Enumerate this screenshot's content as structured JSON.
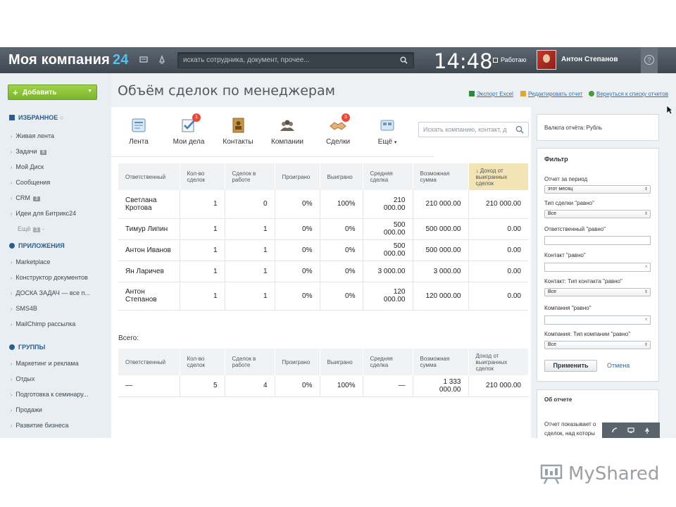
{
  "header": {
    "logo_text": "Моя компания",
    "logo_num": "24",
    "search_placeholder": "искать сотрудника, документ, прочее...",
    "clock": "14:48",
    "status": "Работаю",
    "user_name": "Антон Степанов",
    "help": "?"
  },
  "sidebar": {
    "add_button": "Добавить",
    "favorites_title": "ИЗБРАННОЕ",
    "favorites": [
      {
        "label": "Живая лента",
        "count": ""
      },
      {
        "label": "Задачи",
        "count": "8"
      },
      {
        "label": "Мой Диск",
        "count": ""
      },
      {
        "label": "Сообщения",
        "count": ""
      },
      {
        "label": "CRM",
        "count": "3"
      },
      {
        "label": "Идеи для Битрикс24",
        "count": ""
      }
    ],
    "more_label": "Ещё",
    "more_count": "1",
    "apps_title": "ПРИЛОЖЕНИЯ",
    "apps": [
      {
        "label": "Marketplace"
      },
      {
        "label": "Конструктор документов"
      },
      {
        "label": "ДОСКА ЗАДАЧ — все п..."
      },
      {
        "label": "SMS4B"
      },
      {
        "label": "MailChimp рассылка"
      }
    ],
    "groups_title": "ГРУППЫ",
    "groups": [
      {
        "label": "Маркетинг и реклама"
      },
      {
        "label": "Отдых"
      },
      {
        "label": "Подготовка к семинару..."
      },
      {
        "label": "Продажи"
      },
      {
        "label": "Развитие бизнеса"
      }
    ]
  },
  "page": {
    "title": "Объём сделок по менеджерам",
    "links": {
      "export": "Экспорт Excel",
      "edit": "Редактировать отчет",
      "back": "Вернуться к списку отчетов"
    }
  },
  "toolbar": {
    "items": [
      {
        "label": "Лента",
        "icon": "feed-icon",
        "badge": ""
      },
      {
        "label": "Мои дела",
        "icon": "tasks-icon",
        "badge": "1"
      },
      {
        "label": "Контакты",
        "icon": "contacts-icon",
        "badge": ""
      },
      {
        "label": "Компании",
        "icon": "companies-icon",
        "badge": ""
      },
      {
        "label": "Сделки",
        "icon": "deals-icon",
        "badge": "3"
      },
      {
        "label": "Ещё",
        "icon": "more-icon",
        "badge": ""
      }
    ],
    "search_placeholder": "Искать компанию, контакт, д"
  },
  "report": {
    "columns": [
      "Ответственный",
      "Кол-во сделок",
      "Сделок в работе",
      "Проиграно",
      "Выиграно",
      "Средняя сделка",
      "Возможная сумма",
      "Доход от выигранных сделок"
    ],
    "rows": [
      [
        "Светлана Кротова",
        "1",
        "0",
        "0%",
        "100%",
        "210 000.00",
        "210 000.00",
        "210 000.00"
      ],
      [
        "Тимур Липин",
        "1",
        "1",
        "0%",
        "0%",
        "500 000.00",
        "500 000.00",
        "0.00"
      ],
      [
        "Антон Иванов",
        "1",
        "1",
        "0%",
        "0%",
        "500 000.00",
        "500 000.00",
        "0.00"
      ],
      [
        "Ян Ларичев",
        "1",
        "1",
        "0%",
        "0%",
        "3 000.00",
        "3 000.00",
        "0.00"
      ],
      [
        "Антон Степанов",
        "1",
        "1",
        "0%",
        "0%",
        "120 000.00",
        "120 000.00",
        "0.00"
      ]
    ],
    "total_label": "Всего:",
    "total_row": [
      "—",
      "5",
      "4",
      "0%",
      "100%",
      "—",
      "1 333 000.00",
      "210 000.00"
    ]
  },
  "right": {
    "currency": "Валюта отчёта: Рубль",
    "filter_title": "Фильтр",
    "filters": [
      {
        "label": "Отчет за период",
        "type": "select",
        "value": "этот месяц"
      },
      {
        "label": "Тип сделки \"равно\"",
        "type": "select",
        "value": "Все"
      },
      {
        "label": "Ответственный \"равно\"",
        "type": "input",
        "value": ""
      },
      {
        "label": "Контакт \"равно\"",
        "type": "input_clear",
        "value": ""
      },
      {
        "label": "Контакт: Тип контакта \"равно\"",
        "type": "select",
        "value": "Все"
      },
      {
        "label": "Компания \"равно\"",
        "type": "input_clear",
        "value": ""
      },
      {
        "label": "Компания: Тип компании \"равно\"",
        "type": "select",
        "value": "Все"
      }
    ],
    "apply": "Применить",
    "cancel": "Отмена",
    "about_title": "Об отчете",
    "about_text_1": "Отчет показывает о",
    "about_text_2": "сделок, над которы"
  },
  "watermark": "MyShared"
}
